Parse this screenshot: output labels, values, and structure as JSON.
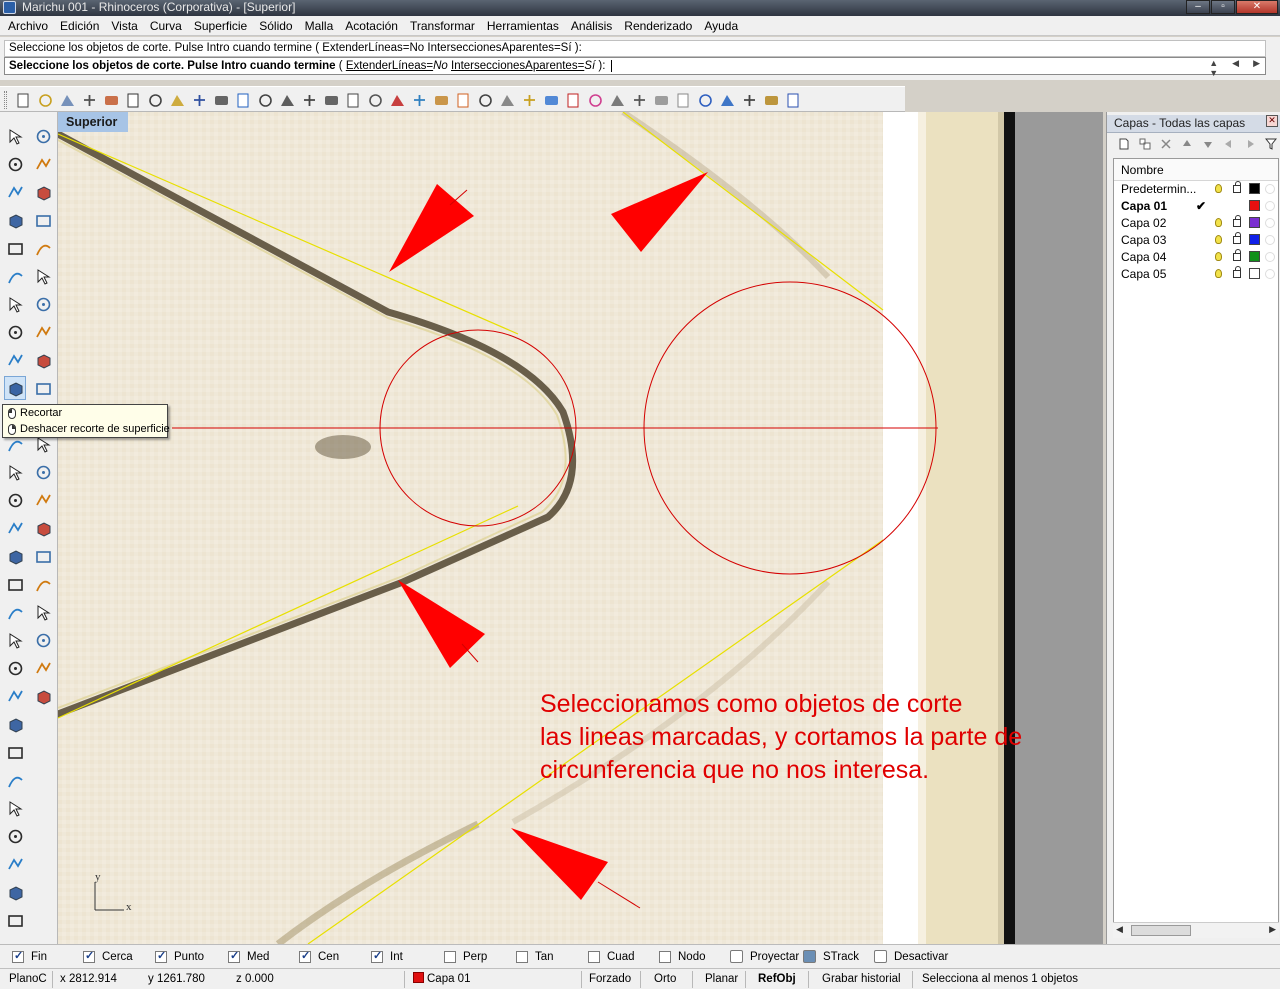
{
  "window": {
    "title": "Marichu 001 - Rhinoceros (Corporativa) - [Superior]"
  },
  "menu": [
    "Archivo",
    "Edición",
    "Vista",
    "Curva",
    "Superficie",
    "Sólido",
    "Malla",
    "Acotación",
    "Transformar",
    "Herramientas",
    "Análisis",
    "Renderizado",
    "Ayuda"
  ],
  "command": {
    "history": "Seleccione los objetos de corte. Pulse Intro cuando termine ( ExtenderLíneas=No  InterseccionesAparentes=Sí ):",
    "prompt": "Seleccione los objetos de corte. Pulse Intro cuando termine",
    "opt_open": "(",
    "opt_extend": "ExtenderLíneas=",
    "opt_extend_val": "No",
    "opt_intersect": "InterseccionesAparentes=",
    "opt_intersect_val": "Sí",
    "opt_close": "):"
  },
  "tooltip": {
    "left_click": "Recortar",
    "right_click": "Deshacer recorte de superficie"
  },
  "viewport": {
    "name": "Superior",
    "annotation": [
      "Seleccionamos como objetos de corte",
      "las lineas marcadas, y cortamos la parte de",
      "circunferencia que no nos interesa."
    ],
    "axis_x": "x",
    "axis_y": "y"
  },
  "layers_panel": {
    "title": "Capas - Todas las capas",
    "column_name": "Nombre",
    "layers": [
      {
        "name": "Predetermin...",
        "color": "#000000",
        "current": false
      },
      {
        "name": "Capa 01",
        "color": "#e81010",
        "current": true
      },
      {
        "name": "Capa 02",
        "color": "#7a2fd0",
        "current": false
      },
      {
        "name": "Capa 03",
        "color": "#1020e8",
        "current": false
      },
      {
        "name": "Capa 04",
        "color": "#10901a",
        "current": false
      },
      {
        "name": "Capa 05",
        "color": "#ffffff",
        "current": false
      }
    ]
  },
  "osnaps": [
    {
      "label": "Fin",
      "on": true
    },
    {
      "label": "Cerca",
      "on": true
    },
    {
      "label": "Punto",
      "on": true
    },
    {
      "label": "Med",
      "on": true
    },
    {
      "label": "Cen",
      "on": true
    },
    {
      "label": "Int",
      "on": true
    },
    {
      "label": "Perp",
      "on": false
    },
    {
      "label": "Tan",
      "on": false
    },
    {
      "label": "Cuad",
      "on": false
    },
    {
      "label": "Nodo",
      "on": false
    },
    {
      "label": "Proyectar",
      "on": false
    },
    {
      "label": "STrack",
      "on": true
    },
    {
      "label": "Desactivar",
      "on": false
    }
  ],
  "status": {
    "cplane": "PlanoC",
    "x": "x 2812.914",
    "y": "y 1261.780",
    "z": "z 0.000",
    "layer": "Capa 01",
    "snap": "Forzado",
    "ortho": "Orto",
    "planar": "Planar",
    "osnap": "RefObj",
    "history": "Grabar historial",
    "message": "Selecciona al menos 1 objetos"
  },
  "colors": {
    "accent_red": "#e00000",
    "viewport_label_bg": "#a7c4e6",
    "construction_yellow": "#e8e000"
  }
}
